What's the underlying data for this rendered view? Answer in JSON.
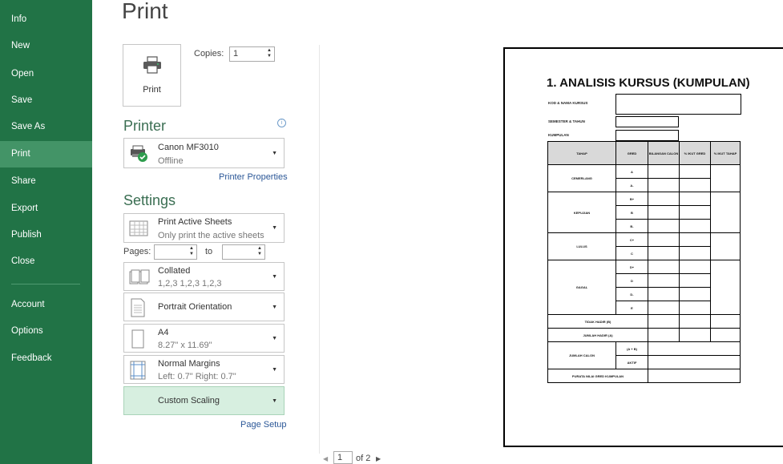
{
  "nav": {
    "items": [
      {
        "label": "Info"
      },
      {
        "label": "New"
      },
      {
        "label": "Open"
      },
      {
        "label": "Save"
      },
      {
        "label": "Save As"
      },
      {
        "label": "Print"
      },
      {
        "label": "Share"
      },
      {
        "label": "Export"
      },
      {
        "label": "Publish"
      },
      {
        "label": "Close"
      },
      {
        "label": "Account"
      },
      {
        "label": "Options"
      },
      {
        "label": "Feedback"
      }
    ]
  },
  "title": "Print",
  "print_button": {
    "label": "Print"
  },
  "copies": {
    "label": "Copies:",
    "value": "1"
  },
  "printer": {
    "heading": "Printer",
    "name": "Canon MF3010",
    "status": "Offline",
    "properties_link": "Printer Properties"
  },
  "settings": {
    "heading": "Settings",
    "sheets": {
      "title": "Print Active Sheets",
      "subtitle": "Only print the active sheets"
    },
    "pages": {
      "label": "Pages:",
      "from": "",
      "to_label": "to",
      "to": ""
    },
    "collation": {
      "title": "Collated",
      "subtitle": "1,2,3   1,2,3   1,2,3"
    },
    "orientation": {
      "title": "Portrait Orientation"
    },
    "paper": {
      "title": "A4",
      "subtitle": "8.27\" x 11.69\""
    },
    "margins": {
      "title": "Normal Margins",
      "subtitle": "Left:  0.7\"    Right:  0.7\""
    },
    "scaling": {
      "title": "Custom Scaling"
    },
    "page_setup_link": "Page Setup"
  },
  "pager": {
    "current": "1",
    "total": "of 2"
  },
  "preview": {
    "title": "1. ANALISIS KURSUS (KUMPULAN)",
    "fields": [
      "KOD & NAMA KURSUS",
      "SEMESTER & TAHUN",
      "KUMPULAN"
    ],
    "headers": [
      "TAHAP",
      "GRED",
      "BILANGAN CALON",
      "% IKUT GRED",
      "% IKUT TAHAP"
    ],
    "groups": [
      {
        "name": "CEMERLANG",
        "grades": [
          "A",
          "A-"
        ]
      },
      {
        "name": "KEPUJIAN",
        "grades": [
          "B+",
          "B",
          "B-"
        ]
      },
      {
        "name": "LULUS",
        "grades": [
          "C+",
          "C"
        ]
      },
      {
        "name": "GAGAL",
        "grades": [
          "D+",
          "D",
          "D-",
          "E"
        ]
      }
    ],
    "rows_after": {
      "tidak_hadir": "TIDAK HADIR (B)",
      "jumlah_hadir": "JUMLAH HADIR (A)",
      "jumlah_calon": "JUMLAH CALON",
      "a_plus_b": "(A + B)",
      "aktif": "AKTIF",
      "purata": "PURATA NILAI GRED KUMPULAN"
    }
  },
  "colors": {
    "nav_bg": "#217346",
    "nav_active": "#439467",
    "accent": "#3a6e52",
    "scaling_bg": "#d7efe0"
  }
}
